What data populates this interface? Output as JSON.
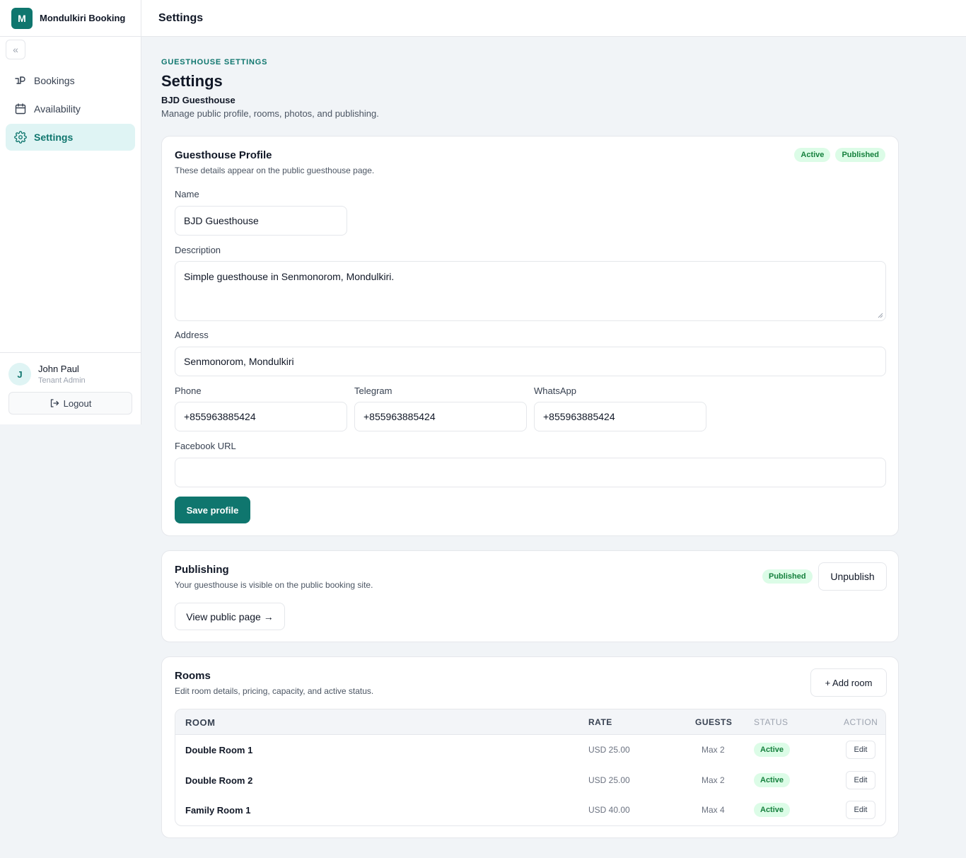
{
  "brand": {
    "logo_letter": "M",
    "name": "Mondulkiri Booking"
  },
  "topbar": {
    "title": "Settings"
  },
  "sidebar": {
    "collapse_glyph": "«",
    "items": [
      {
        "label": "Bookings",
        "icon": "bookings-icon"
      },
      {
        "label": "Availability",
        "icon": "calendar-icon"
      },
      {
        "label": "Settings",
        "icon": "gear-icon",
        "active": true
      }
    ]
  },
  "user": {
    "initial": "J",
    "name": "John Paul",
    "role": "Tenant Admin",
    "logout_label": "Logout"
  },
  "page": {
    "eyebrow": "GUESTHOUSE SETTINGS",
    "title": "Settings",
    "subtitle": "BJD Guesthouse",
    "description": "Manage public profile, rooms, photos, and publishing."
  },
  "profile": {
    "title": "Guesthouse Profile",
    "description": "These details appear on the public guesthouse page.",
    "badges": [
      "Active",
      "Published"
    ],
    "name_label": "Name",
    "name_value": "BJD Guesthouse",
    "description_label": "Description",
    "description_value": "Simple guesthouse in Senmonorom, Mondulkiri.",
    "address_label": "Address",
    "address_value": "Senmonorom, Mondulkiri",
    "phone_label": "Phone",
    "phone_value": "+855963885424",
    "telegram_label": "Telegram",
    "telegram_value": "+855963885424",
    "whatsapp_label": "WhatsApp",
    "whatsapp_value": "+855963885424",
    "facebook_label": "Facebook URL",
    "facebook_value": "",
    "save_label": "Save profile"
  },
  "publishing": {
    "title": "Publishing",
    "description": "Your guesthouse is visible on the public booking site.",
    "badge": "Published",
    "unpublish_label": "Unpublish",
    "view_label": "View public page →"
  },
  "rooms": {
    "title": "Rooms",
    "description": "Edit room details, pricing, capacity, and active status.",
    "add_label": "+ Add room",
    "columns": [
      "ROOM",
      "RATE",
      "GUESTS",
      "STATUS",
      "ACTION"
    ],
    "rows": [
      {
        "name": "Double Room 1",
        "rate": "USD 25.00",
        "guests": "Max 2",
        "status": "Active",
        "action": "Edit"
      },
      {
        "name": "Double Room 2",
        "rate": "USD 25.00",
        "guests": "Max 2",
        "status": "Active",
        "action": "Edit"
      },
      {
        "name": "Family Room 1",
        "rate": "USD 40.00",
        "guests": "Max 4",
        "status": "Active",
        "action": "Edit"
      }
    ]
  },
  "colors": {
    "brand": "#0f766e",
    "active_nav_bg": "#dff4f4",
    "badge_bg": "#dcfce7",
    "badge_text": "#15803d"
  }
}
